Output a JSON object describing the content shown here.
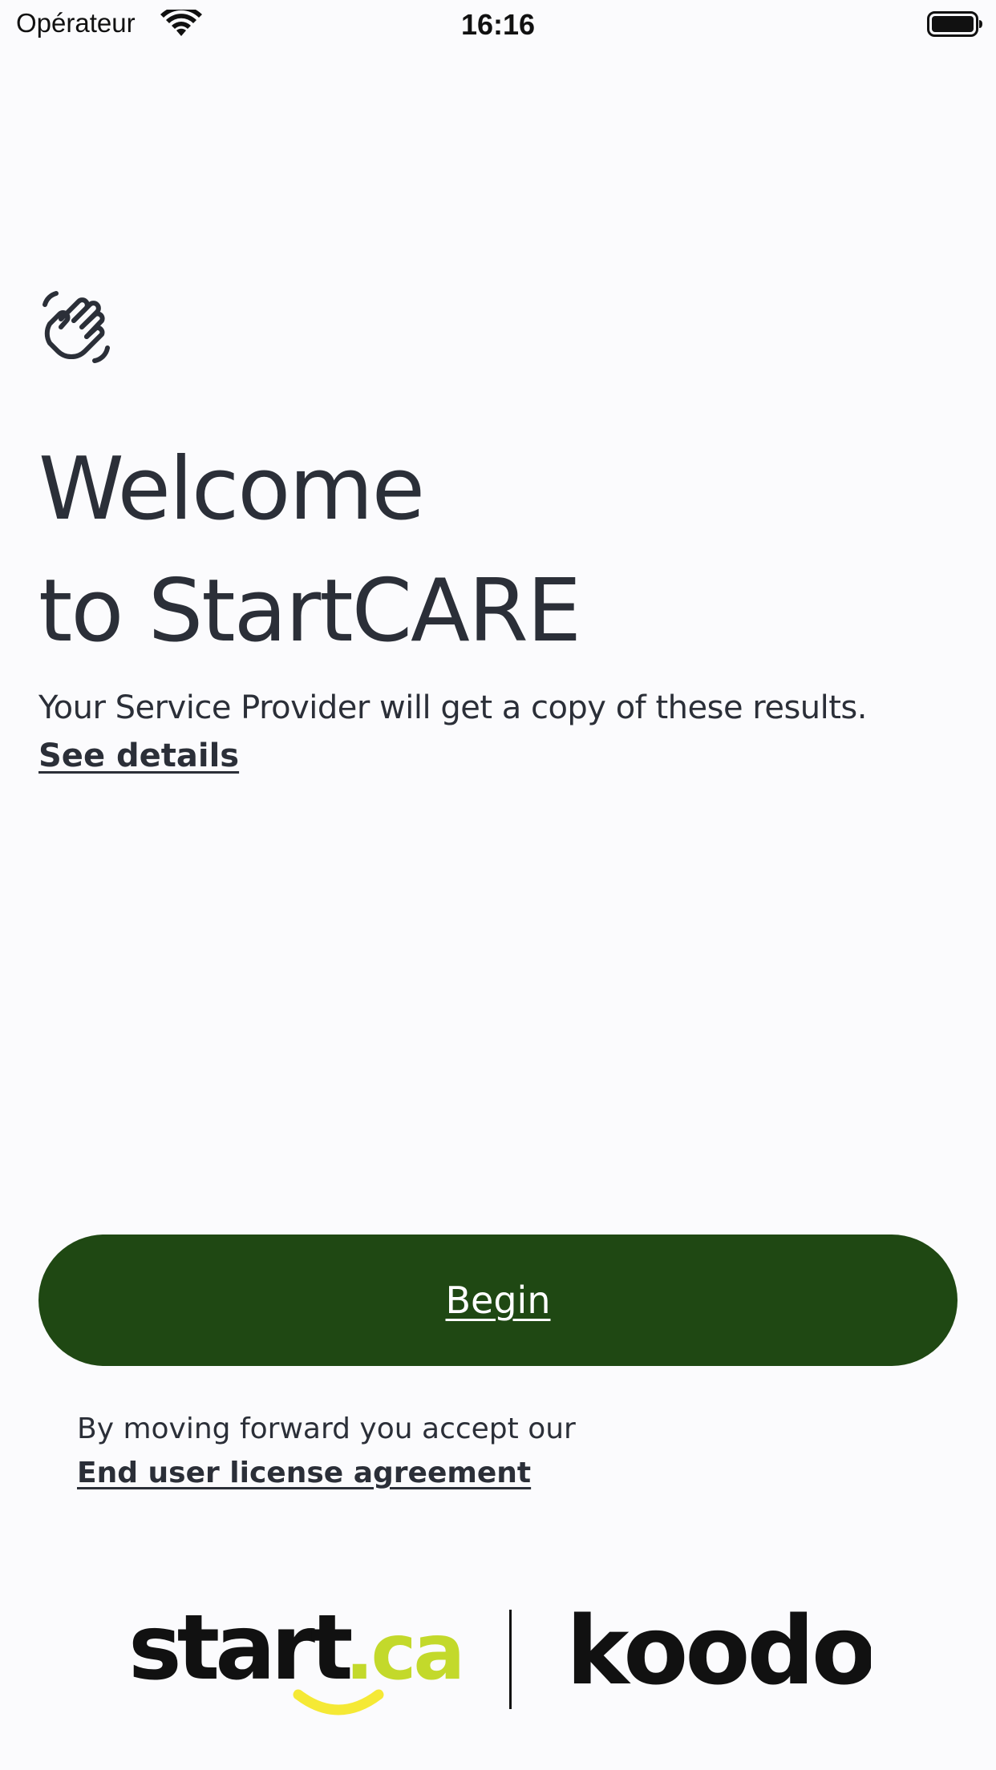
{
  "status_bar": {
    "carrier": "Opérateur",
    "time": "16:16",
    "wifi_icon": "wifi-icon",
    "battery_icon": "battery-icon"
  },
  "main": {
    "icon": "waving-hand-icon",
    "title_line1": "Welcome",
    "title_line2": "to StartCARE",
    "subtitle": "Your Service Provider will get a copy of these results.",
    "see_details": "See details"
  },
  "cta": {
    "begin_label": "Begin"
  },
  "legal": {
    "consent_text": "By moving forward you accept our",
    "eula_link": "End user license agreement"
  },
  "footer": {
    "start_logo_text": "start",
    "start_logo_suffix": ".ca",
    "koodo_logo_text": "koodo"
  },
  "colors": {
    "background": "#fbfbfd",
    "text": "#2b2f38",
    "button": "#1f4813",
    "start_accent_green": "#c3d92b",
    "start_accent_yellow": "#f5e935"
  }
}
